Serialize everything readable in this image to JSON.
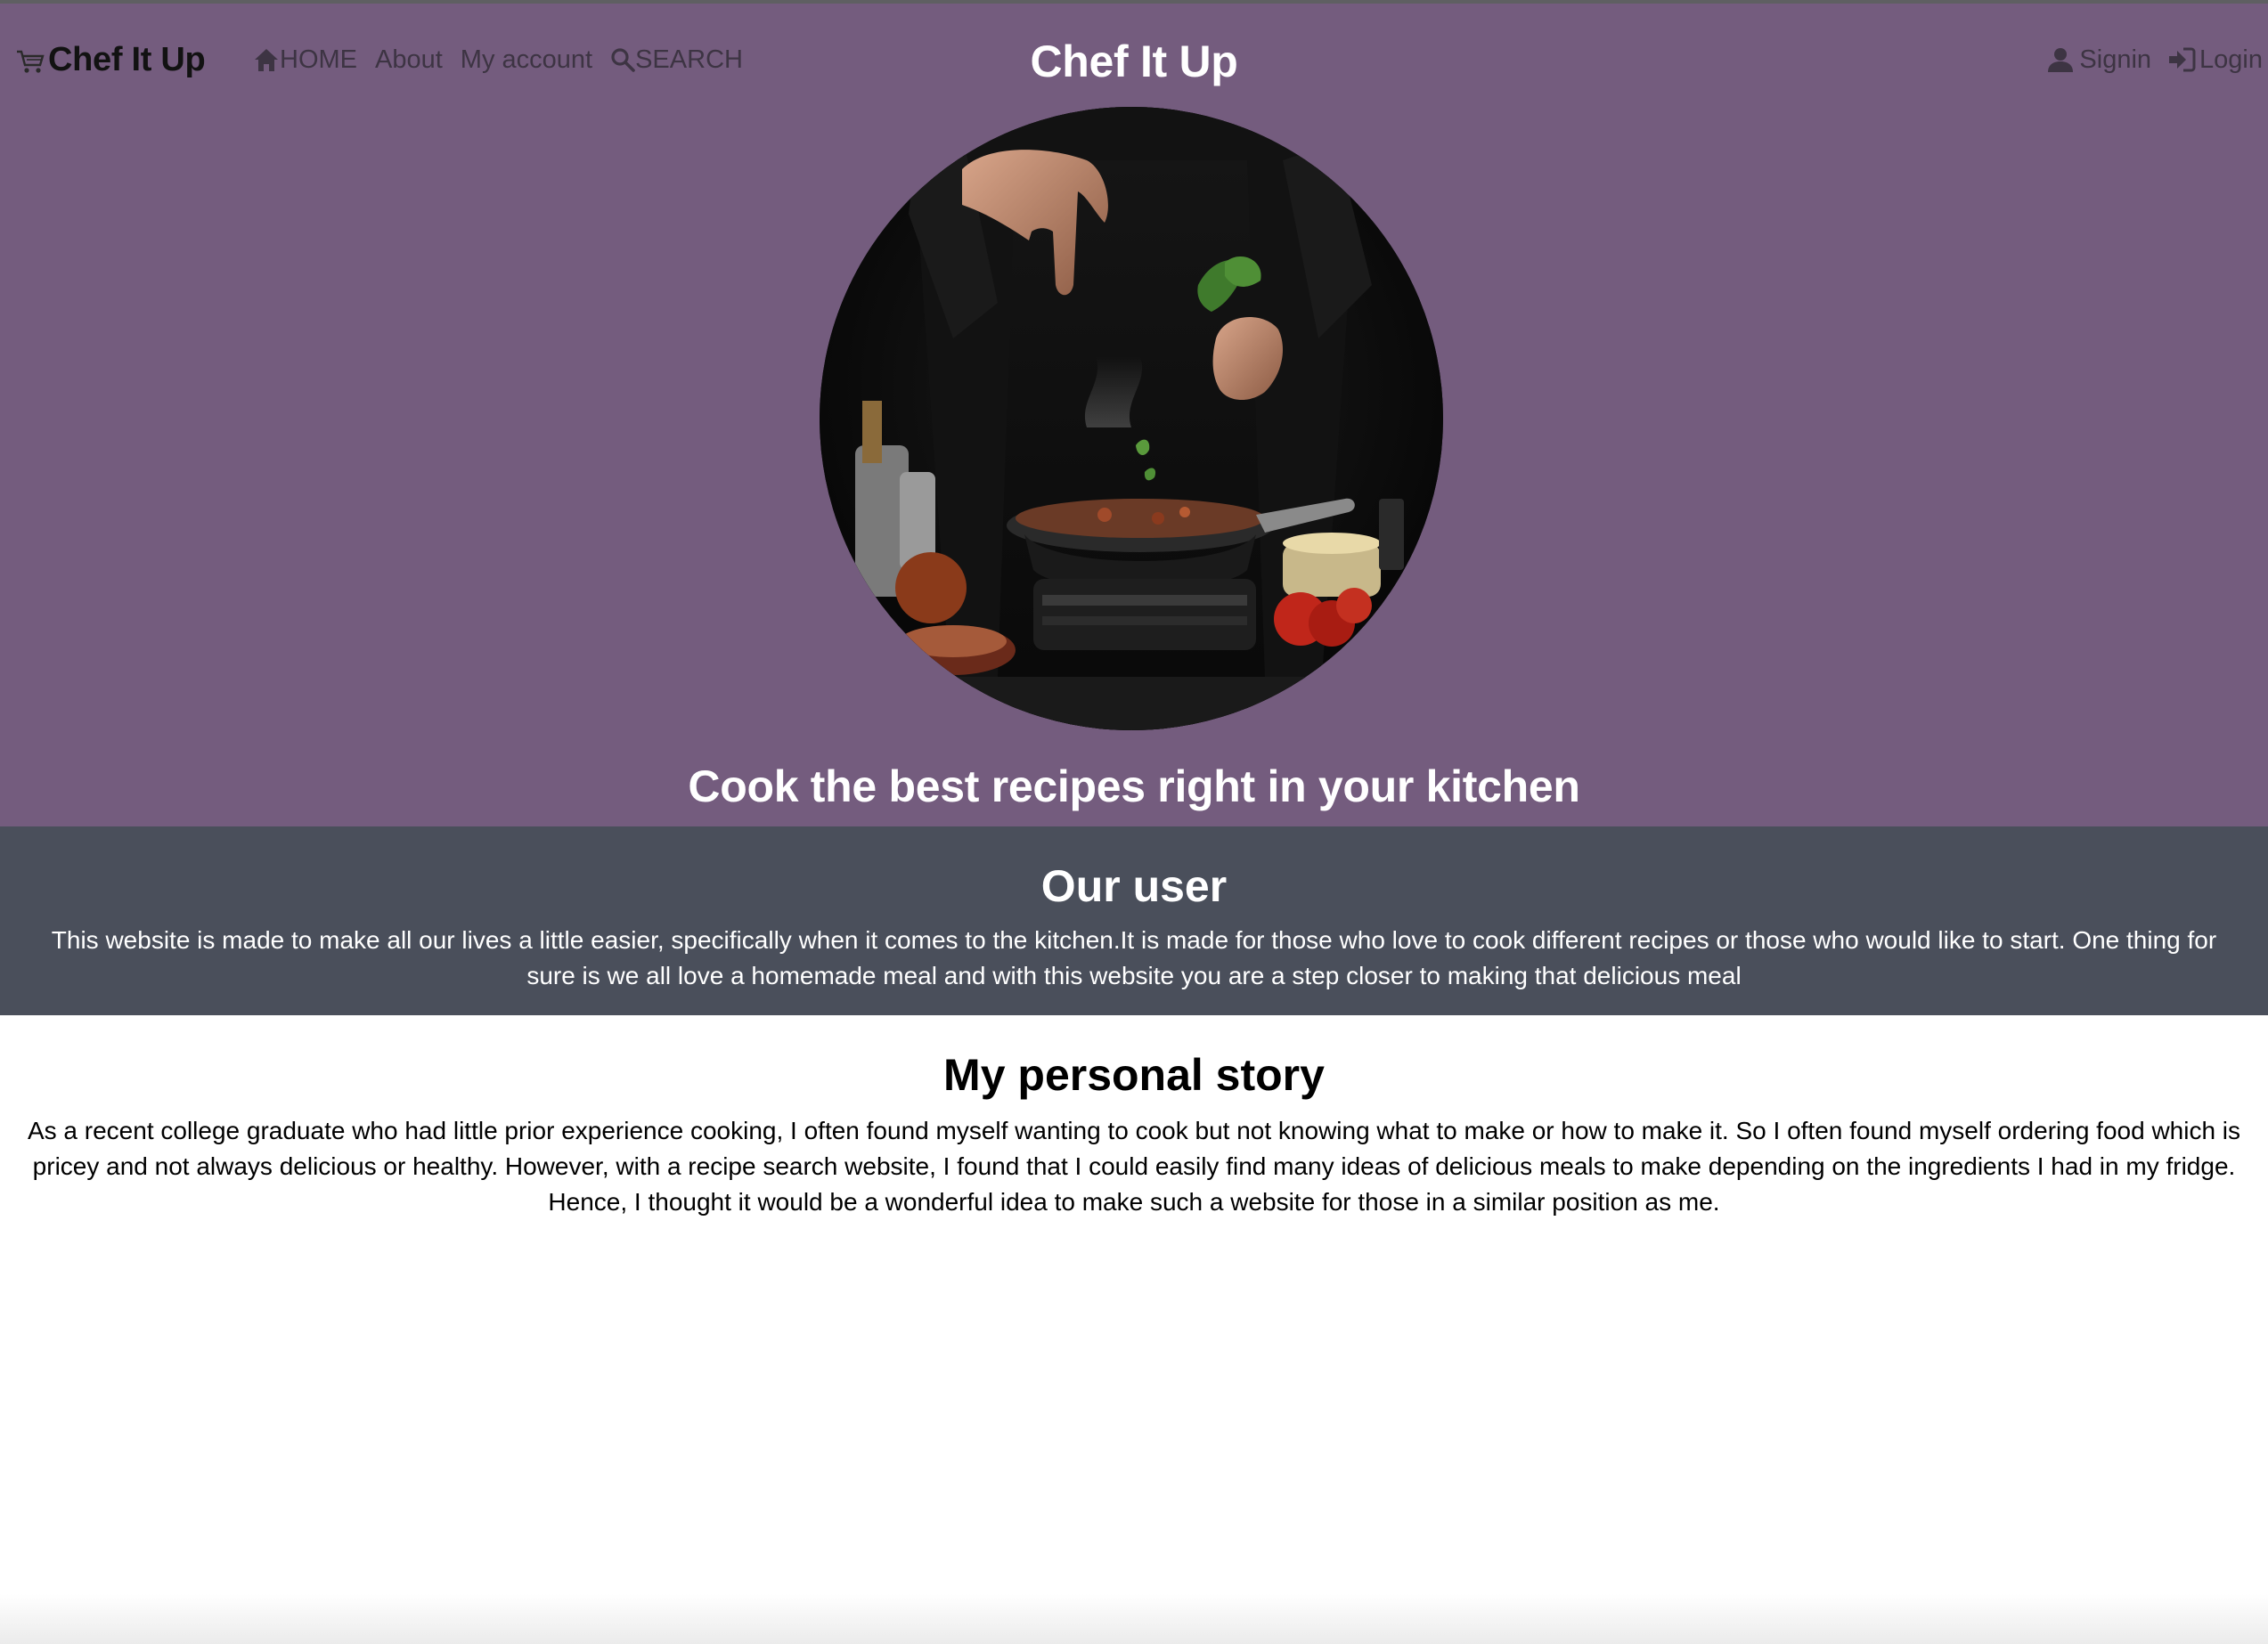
{
  "navbar": {
    "brand_icon": "shopping-cart-icon",
    "brand": "Chef It Up",
    "links": [
      {
        "label": "HOME",
        "icon": "home-icon"
      },
      {
        "label": "About"
      },
      {
        "label": "My account"
      },
      {
        "label": "SEARCH",
        "icon": "search-icon"
      }
    ],
    "right_links": [
      {
        "label": "Signin",
        "icon": "user-icon"
      },
      {
        "label": "Login",
        "icon": "login-icon"
      }
    ]
  },
  "hero": {
    "title": "Chef It Up",
    "tagline": "Cook the best recipes right in your kitchen",
    "image": "chef-cooking-photo"
  },
  "users": {
    "heading": "Our user",
    "text": "This website is made to make all our lives a little easier, specifically when it comes to the kitchen.It is made for those who love to cook different recipes or those who would like to start. One thing for sure is we all love a homemade meal and with this website you are a step closer to making that delicious meal"
  },
  "story": {
    "heading": "My personal story",
    "text": "As a recent college graduate who had little prior experience cooking, I often found myself wanting to cook but not knowing what to make or how to make it. So I often found myself ordering food which is pricey and not always delicious or healthy. However, with a recipe search website, I found that I could easily find many ideas of delicious meals to make depending on the ingredients I had in my fridge. Hence, I thought it would be a wonderful idea to make such a website for those in a similar position as me."
  },
  "colors": {
    "hero_bg": "#745c7e",
    "users_bg": "#4a4f5b",
    "nav_text": "#3d3443"
  }
}
